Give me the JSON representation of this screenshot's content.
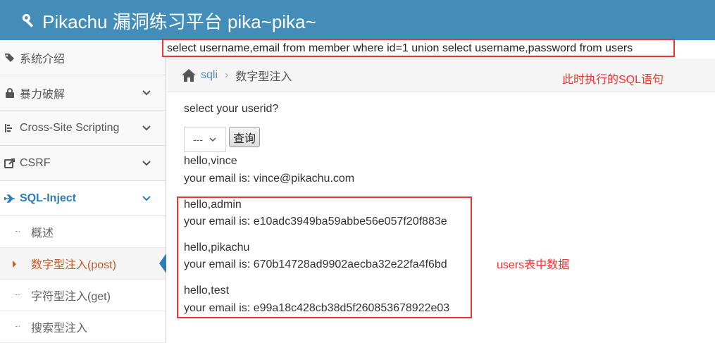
{
  "header": {
    "title": "Pikachu 漏洞练习平台 pika~pika~",
    "icon": "wrench-icon"
  },
  "sidebar": {
    "items": [
      {
        "label": "系统介绍",
        "icon": "tags-icon",
        "expandable": false
      },
      {
        "label": "暴力破解",
        "icon": "lock-icon",
        "expandable": true
      },
      {
        "label": "Cross-Site Scripting",
        "icon": "list-icon",
        "expandable": true
      },
      {
        "label": "CSRF",
        "icon": "share-icon",
        "expandable": true
      },
      {
        "label": "SQL-Inject",
        "icon": "plane-icon",
        "expandable": true,
        "active": true
      }
    ],
    "subitems": [
      {
        "label": "概述"
      },
      {
        "label": "数字型注入(post)",
        "active": true
      },
      {
        "label": "字符型注入(get)"
      },
      {
        "label": "搜索型注入"
      }
    ]
  },
  "sql_query": "select username,email from member where id=1 union select username,password from users",
  "breadcrumb": {
    "link": "sqli",
    "current": "数字型注入"
  },
  "annotations": {
    "sql_note": "此时执行的SQL语句",
    "users_note": "users表中数据"
  },
  "form": {
    "prompt": "select your userid?",
    "select_value": "---",
    "query_button": "查询"
  },
  "results": [
    {
      "hello": "hello,vince",
      "email": "your email is: vince@pikachu.com"
    },
    {
      "hello": "hello,admin",
      "email": "your email is: e10adc3949ba59abbe56e057f20f883e"
    },
    {
      "hello": "hello,pikachu",
      "email": "your email is: 670b14728ad9902aecba32e22fa4f6bd"
    },
    {
      "hello": "hello,test",
      "email": "your email is: e99a18c428cb38d5f260853678922e03"
    }
  ],
  "colors": {
    "header": "#438eb9",
    "active": "#2b7dbc",
    "active_sub": "#c15c2a",
    "highlight": "#e33333"
  }
}
